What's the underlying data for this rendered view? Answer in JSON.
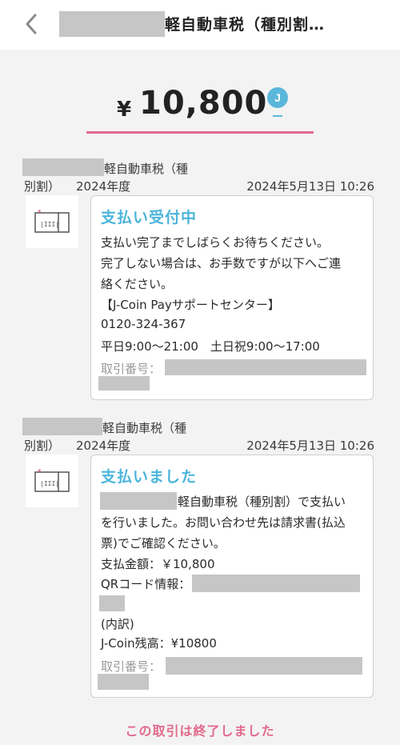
{
  "header": {
    "title": "軽自動車税（種別割…"
  },
  "amount": {
    "currency": "¥",
    "value": "10,800",
    "coin_label": "J"
  },
  "transactions": [
    {
      "name_suffix": "軽自動車税（種",
      "line2_prefix": "別割）",
      "fiscal_year": "2024年度",
      "datetime": "2024年5月13日 10:26",
      "status": "支払い受付中",
      "lines": [
        "支払い完了までしばらくお待ちください。",
        "完了しない場合は、お手数ですが以下へご連",
        "絡ください。",
        "【J-Coin Payサポートセンター】",
        "0120-324-367",
        "平日9:00～21:00　土日祝9:00～17:00"
      ],
      "tx_number_label": "取引番号："
    },
    {
      "name_suffix": "軽自動車税（種",
      "line2_prefix": "別割）",
      "fiscal_year": "2024年度",
      "datetime": "2024年5月13日 10:26",
      "status": "支払いました",
      "first_line_suffix": "軽自動車税（種別割）で支払い",
      "lines": [
        "を行いました。お問い合わせ先は請求書(払込",
        "票)でご確認ください。",
        "支払金額：￥10,800"
      ],
      "qr_label": "QRコード情報：",
      "breakdown_label": "(内訳)",
      "balance": "J-Coin残高：¥10800",
      "tx_number_label": "取引番号："
    }
  ],
  "footer": {
    "message": "この取引は終了しました"
  },
  "colors": {
    "accent_pink": "#e26a8d",
    "accent_blue": "#4db5da"
  }
}
